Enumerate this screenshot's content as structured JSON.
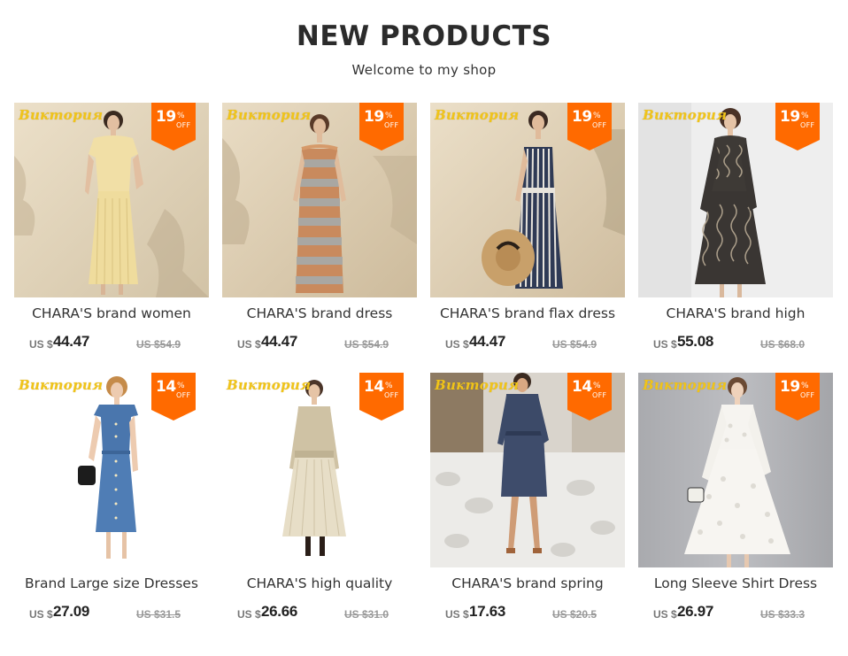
{
  "header": {
    "title": "NEW PRODUCTS",
    "subtitle": "Welcome to my shop"
  },
  "colors": {
    "badge": "#ff6a00",
    "brand_script": "#f0c419",
    "text": "#333333",
    "old_price": "#999999"
  },
  "products": [
    {
      "brand_script": "Виктория",
      "discount": "19",
      "pct": "%",
      "off": "OFF",
      "name": "CHARA'S brand women",
      "currency": "US $",
      "price": "44.47",
      "old_price": "US $54.9",
      "image": "beige-pleated-dress-photo"
    },
    {
      "brand_script": "Виктория",
      "discount": "19",
      "pct": "%",
      "off": "OFF",
      "name": "CHARA'S brand dress",
      "currency": "US $",
      "price": "44.47",
      "old_price": "US $54.9",
      "image": "striped-knit-dress-photo"
    },
    {
      "brand_script": "Виктория",
      "discount": "19",
      "pct": "%",
      "off": "OFF",
      "name": "CHARA'S brand flax dress",
      "currency": "US $",
      "price": "44.47",
      "old_price": "US $54.9",
      "image": "striped-slip-dress-photo"
    },
    {
      "brand_script": "Виктория",
      "discount": "19",
      "pct": "%",
      "off": "OFF",
      "name": "CHARA'S brand high",
      "currency": "US $",
      "price": "55.08",
      "old_price": "US $68.0",
      "image": "printed-chiffon-dress-photo"
    },
    {
      "brand_script": "Виктория",
      "discount": "14",
      "pct": "%",
      "off": "OFF",
      "name": "Brand Large size Dresses",
      "currency": "US $",
      "price": "27.09",
      "old_price": "US $31.5",
      "image": "denim-shirt-dress-photo"
    },
    {
      "brand_script": "Виктория",
      "discount": "14",
      "pct": "%",
      "off": "OFF",
      "name": "CHARA'S high quality",
      "currency": "US $",
      "price": "26.66",
      "old_price": "US $31.0",
      "image": "mesh-tulle-dress-photo"
    },
    {
      "brand_script": "Виктория",
      "discount": "14",
      "pct": "%",
      "off": "OFF",
      "name": "CHARA'S brand spring",
      "currency": "US $",
      "price": "17.63",
      "old_price": "US $20.5",
      "image": "navy-shirt-dress-photo"
    },
    {
      "brand_script": "Виктория",
      "discount": "19",
      "pct": "%",
      "off": "OFF",
      "name": "Long Sleeve Shirt Dress",
      "currency": "US $",
      "price": "26.97",
      "old_price": "US $33.3",
      "image": "white-lace-dress-photo"
    }
  ]
}
